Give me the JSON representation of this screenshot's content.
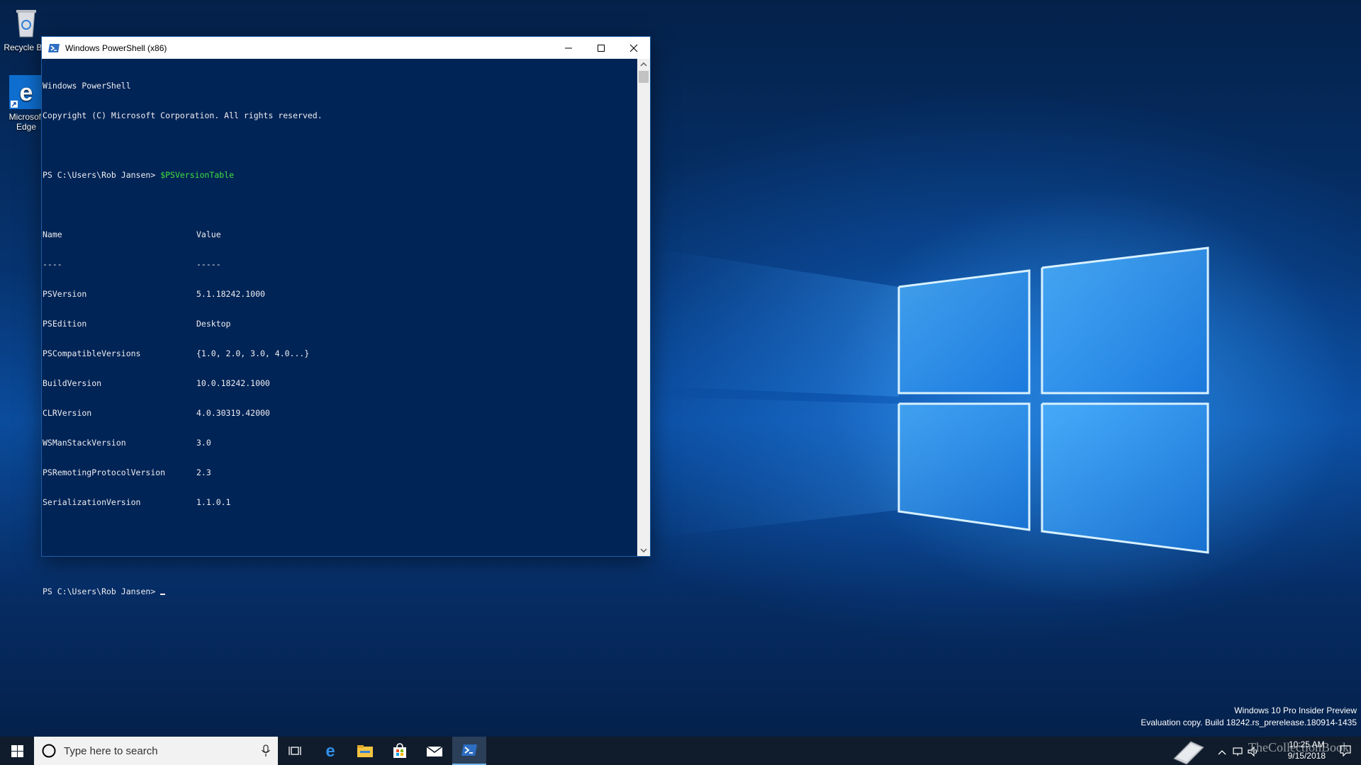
{
  "desktop": {
    "icons": [
      {
        "label": "Recycle Bin",
        "icon": "recycle-bin-icon"
      },
      {
        "label": "Microsoft Edge",
        "icon": "edge-icon"
      }
    ]
  },
  "powershell": {
    "title": "Windows PowerShell (x86)",
    "banner1": "Windows PowerShell",
    "banner2": "Copyright (C) Microsoft Corporation. All rights reserved.",
    "prompt": "PS C:\\Users\\Rob Jansen>",
    "command": "$PSVersionTable",
    "table_headers": [
      "Name",
      "Value"
    ],
    "table_rules": [
      "----",
      "-----"
    ],
    "table_rows": [
      {
        "name": "PSVersion",
        "value": "5.1.18242.1000"
      },
      {
        "name": "PSEdition",
        "value": "Desktop"
      },
      {
        "name": "PSCompatibleVersions",
        "value": "{1.0, 2.0, 3.0, 4.0...}"
      },
      {
        "name": "BuildVersion",
        "value": "10.0.18242.1000"
      },
      {
        "name": "CLRVersion",
        "value": "4.0.30319.42000"
      },
      {
        "name": "WSManStackVersion",
        "value": "3.0"
      },
      {
        "name": "PSRemotingProtocolVersion",
        "value": "2.3"
      },
      {
        "name": "SerializationVersion",
        "value": "1.1.0.1"
      }
    ],
    "command_color": "#3ee03e",
    "background_color": "#012456"
  },
  "watermark": {
    "line1": "Windows 10 Pro Insider Preview",
    "line2": "Evaluation copy. Build 18242.rs_prerelease.180914-1435"
  },
  "taskbar": {
    "search_placeholder": "Type here to search",
    "apps": [
      "task-view-icon",
      "edge-icon",
      "file-explorer-icon",
      "store-icon",
      "mail-icon",
      "powershell-icon"
    ],
    "clock_time": "10:25 AM",
    "clock_date": "9/15/2018",
    "brand": "TheCollectionBook"
  }
}
